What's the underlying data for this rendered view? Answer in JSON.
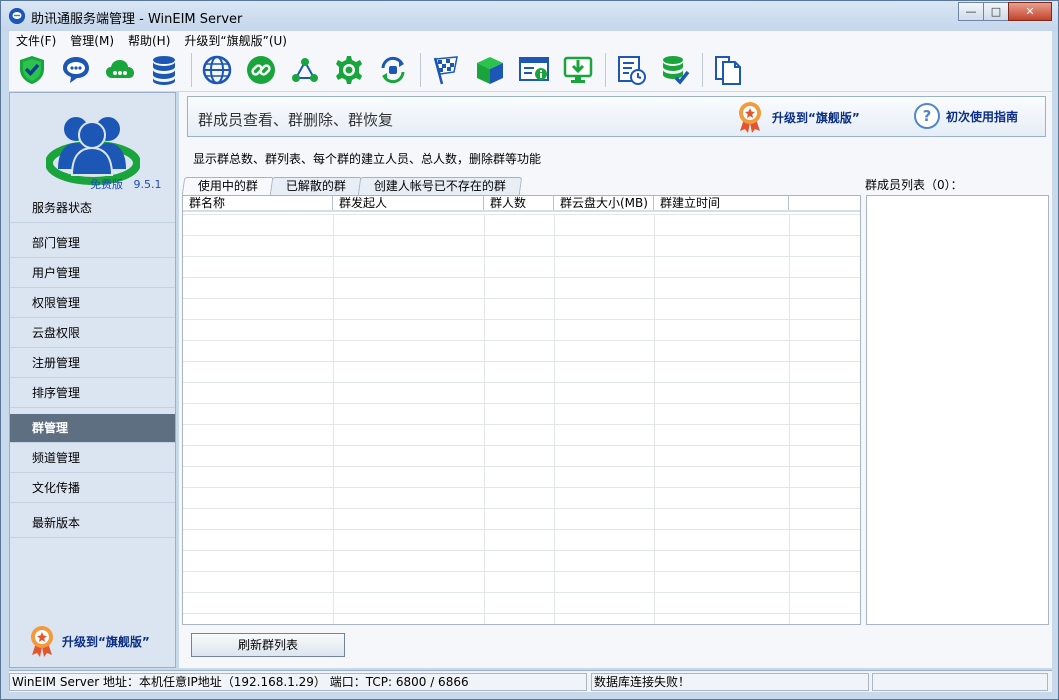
{
  "window": {
    "title": "助讯通服务端管理 - WinEIM Server",
    "minimize": "—",
    "maximize": "□",
    "close": "✕"
  },
  "menu": [
    {
      "label": "文件(F)"
    },
    {
      "label": "管理(M)"
    },
    {
      "label": "帮助(H)"
    },
    {
      "label": "升级到“旗舰版”(U)"
    }
  ],
  "toolbar": {
    "icons": [
      "shield-check-icon",
      "chat-bubble-icon",
      "cloud-icon",
      "database-icon",
      "globe-icon",
      "link-icon",
      "network-icon",
      "gear-icon",
      "sync-icon",
      "checkered-flag-icon",
      "cube-icon",
      "browser-info-icon",
      "download-monitor-icon",
      "schedule-document-icon",
      "database-check-icon",
      "copy-document-icon"
    ]
  },
  "sidebar": {
    "edition": "免费版",
    "version": "9.5.1",
    "items": [
      {
        "label": "服务器状态"
      },
      {
        "label": "部门管理"
      },
      {
        "label": "用户管理"
      },
      {
        "label": "权限管理"
      },
      {
        "label": "云盘权限"
      },
      {
        "label": "注册管理"
      },
      {
        "label": "排序管理"
      },
      {
        "label": "群管理"
      },
      {
        "label": "频道管理"
      },
      {
        "label": "文化传播"
      },
      {
        "label": "最新版本"
      }
    ],
    "active_index": 7,
    "upgrade_label": "升级到“旗舰版”"
  },
  "header": {
    "title": "群成员查看、群删除、群恢复",
    "upgrade_label": "升级到“旗舰版”",
    "guide_label": "初次使用指南",
    "guide_symbol": "?"
  },
  "description": "显示群总数、群列表、每个群的建立人员、总人数，删除群等功能",
  "tabs": [
    {
      "label": "使用中的群"
    },
    {
      "label": "已解散的群"
    },
    {
      "label": "创建人帐号已不存在的群"
    }
  ],
  "group_table": {
    "columns": [
      "群名称",
      "群发起人",
      "群人数",
      "群云盘大小(MB)",
      "群建立时间"
    ],
    "rows": []
  },
  "member_list": {
    "label": "群成员列表（0）："
  },
  "refresh_button": "刷新群列表",
  "status": {
    "address": "WinEIM Server 地址：本机任意IP地址（192.168.1.29）  端口：TCP: 6800 / 6866",
    "db": "数据库连接失败！"
  },
  "colors": {
    "accent_green": "#1aa53c",
    "accent_blue": "#1d57b5",
    "active_nav": "#5f6f82",
    "link_blue": "#0b2f86"
  }
}
